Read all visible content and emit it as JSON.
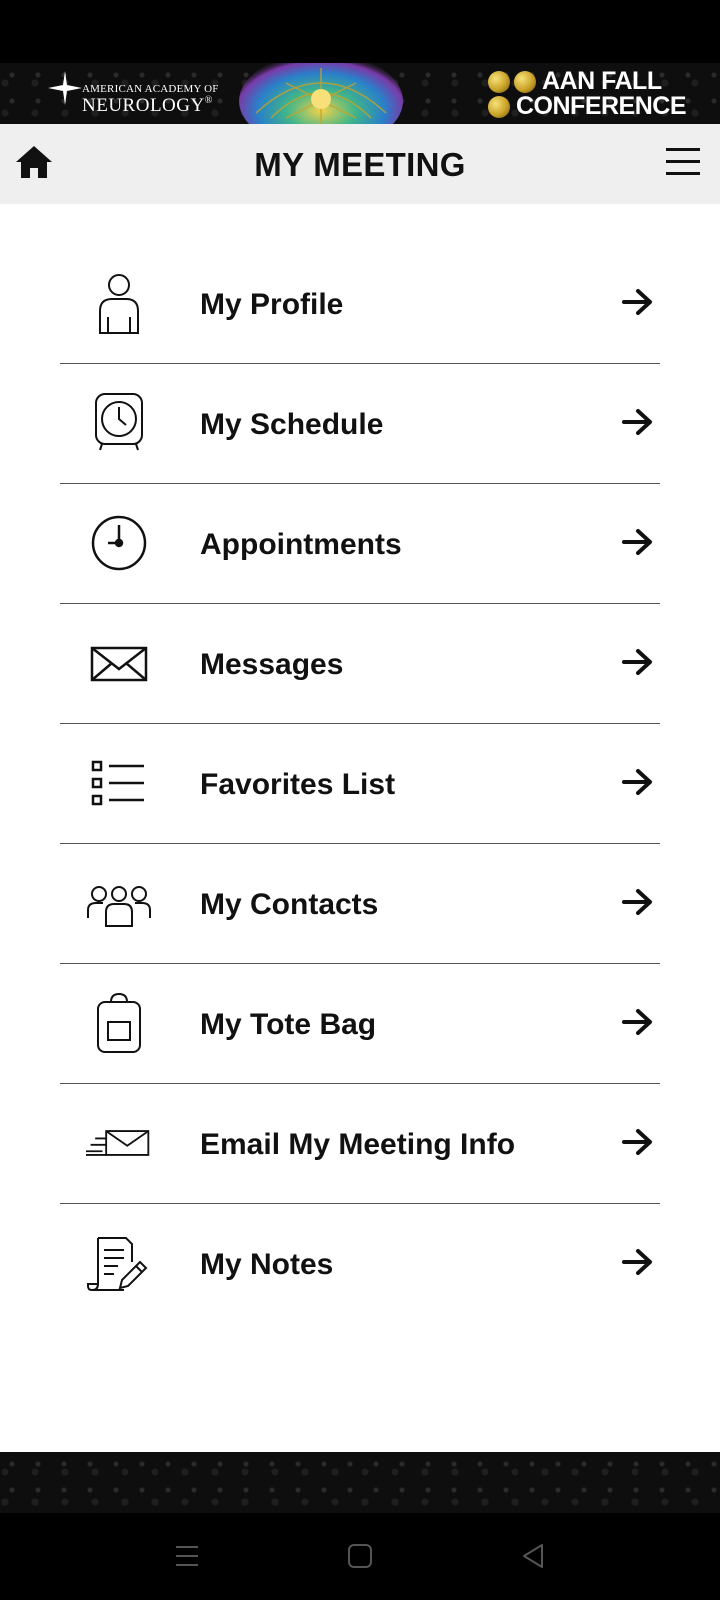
{
  "banner": {
    "org_line1": "AMERICAN ACADEMY OF",
    "org_line2": "NEUROLOGY",
    "org_reg": "®",
    "conference_line1": "AAN FALL",
    "conference_line2": "CONFERENCE"
  },
  "header": {
    "title": "MY MEETING",
    "home_icon": "home-icon",
    "menu_icon": "hamburger-menu-icon"
  },
  "menu": {
    "items": [
      {
        "label": "My Profile",
        "icon": "person-icon"
      },
      {
        "label": "My Schedule",
        "icon": "alarm-clock-icon"
      },
      {
        "label": "Appointments",
        "icon": "clock-icon"
      },
      {
        "label": "Messages",
        "icon": "envelope-icon"
      },
      {
        "label": "Favorites List",
        "icon": "checklist-icon"
      },
      {
        "label": "My Contacts",
        "icon": "group-icon"
      },
      {
        "label": "My Tote Bag",
        "icon": "tote-bag-icon"
      },
      {
        "label": "Email My Meeting Info",
        "icon": "send-mail-icon"
      },
      {
        "label": "My Notes",
        "icon": "notes-pencil-icon"
      }
    ],
    "arrow_icon": "arrow-right-icon"
  },
  "colors": {
    "header_bg": "#efefef",
    "text": "#111111",
    "banner_bg": "#0e0e0e"
  }
}
